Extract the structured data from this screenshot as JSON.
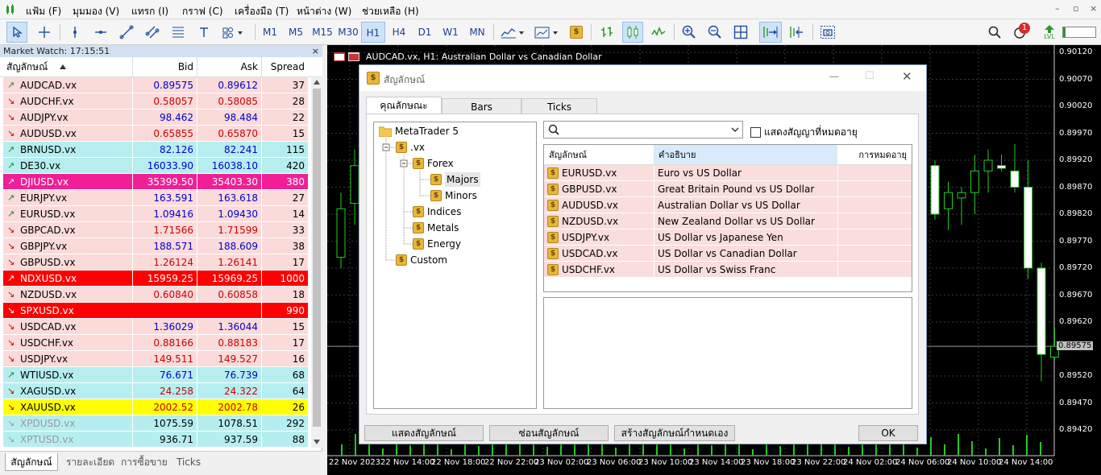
{
  "menu": {
    "items": [
      "แฟ้ม (F)",
      "มุมมอง (V)",
      "แทรก (I)",
      "กราฟ (C)",
      "เครื่องมือ (T)",
      "หน้าต่าง (W)",
      "ช่วยเหลือ (H)"
    ],
    "win_controls": [
      "–",
      "▫",
      "×"
    ]
  },
  "toolbar": {
    "timeframes": [
      "M1",
      "M5",
      "M15",
      "M30",
      "H1",
      "H4",
      "D1",
      "W1",
      "MN"
    ],
    "active_timeframe": "H1",
    "notification_count": "1",
    "lvl_label": "LVL"
  },
  "market_watch": {
    "title": "Market Watch: 17:15:51",
    "close": "×",
    "headers": {
      "symbol": "สัญลักษณ์",
      "bid": "Bid",
      "ask": "Ask",
      "spread": "Spread"
    },
    "rows": [
      {
        "arrow": "↗",
        "symbol": "AUDCAD.vx",
        "bid": "0.89575",
        "ask": "0.89612",
        "spread": "37",
        "bg": "#fbdada",
        "color": "#0000cc",
        "arrowColor": "#1a8a1a"
      },
      {
        "arrow": "↘",
        "symbol": "AUDCHF.vx",
        "bid": "0.58057",
        "ask": "0.58085",
        "spread": "28",
        "bg": "#fbdada",
        "color": "#cc0000",
        "arrowColor": "#cc0000"
      },
      {
        "arrow": "↘",
        "symbol": "AUDJPY.vx",
        "bid": "98.462",
        "ask": "98.484",
        "spread": "22",
        "bg": "#fbdada",
        "color": "#0000cc",
        "arrowColor": "#cc0000"
      },
      {
        "arrow": "↘",
        "symbol": "AUDUSD.vx",
        "bid": "0.65855",
        "ask": "0.65870",
        "spread": "15",
        "bg": "#fbdada",
        "color": "#cc0000",
        "arrowColor": "#cc0000"
      },
      {
        "arrow": "↗",
        "symbol": "BRNUSD.vx",
        "bid": "82.126",
        "ask": "82.241",
        "spread": "115",
        "bg": "#b6eef0",
        "color": "#0000cc",
        "arrowColor": "#1a8a1a"
      },
      {
        "arrow": "↗",
        "symbol": "DE30.vx",
        "bid": "16033.90",
        "ask": "16038.10",
        "spread": "420",
        "bg": "#b6eef0",
        "color": "#0000cc",
        "arrowColor": "#1a8a1a"
      },
      {
        "arrow": "↗",
        "symbol": "DJIUSD.vx",
        "bid": "35399.50",
        "ask": "35403.30",
        "spread": "380",
        "bg": "#f01f96",
        "color": "#0000cc",
        "arrowColor": "#1a8a1a",
        "textColor": "#ffffff"
      },
      {
        "arrow": "↗",
        "symbol": "EURJPY.vx",
        "bid": "163.591",
        "ask": "163.618",
        "spread": "27",
        "bg": "#fbdada",
        "color": "#0000cc",
        "arrowColor": "#1a8a1a"
      },
      {
        "arrow": "↗",
        "symbol": "EURUSD.vx",
        "bid": "1.09416",
        "ask": "1.09430",
        "spread": "14",
        "bg": "#fbdada",
        "color": "#0000cc",
        "arrowColor": "#1a8a1a"
      },
      {
        "arrow": "↘",
        "symbol": "GBPCAD.vx",
        "bid": "1.71566",
        "ask": "1.71599",
        "spread": "33",
        "bg": "#fbdada",
        "color": "#cc0000",
        "arrowColor": "#cc0000"
      },
      {
        "arrow": "↘",
        "symbol": "GBPJPY.vx",
        "bid": "188.571",
        "ask": "188.609",
        "spread": "38",
        "bg": "#fbdada",
        "color": "#0000cc",
        "arrowColor": "#cc0000"
      },
      {
        "arrow": "↘",
        "symbol": "GBPUSD.vx",
        "bid": "1.26124",
        "ask": "1.26141",
        "spread": "17",
        "bg": "#fbdada",
        "color": "#cc0000",
        "arrowColor": "#cc0000"
      },
      {
        "arrow": "↗",
        "symbol": "NDXUSD.vx",
        "bid": "15959.25",
        "ask": "15969.25",
        "spread": "1000",
        "bg": "#ff0000",
        "color": "#0000cc",
        "arrowColor": "#1a8a1a",
        "textColor": "#ffffff"
      },
      {
        "arrow": "↘",
        "symbol": "NZDUSD.vx",
        "bid": "0.60840",
        "ask": "0.60858",
        "spread": "18",
        "bg": "#fbdada",
        "color": "#cc0000",
        "arrowColor": "#cc0000"
      },
      {
        "arrow": "↘",
        "symbol": "SPXUSD.vx",
        "bid": "",
        "ask": "",
        "spread": "990",
        "bg": "#ff0000",
        "color": "#ffffff",
        "arrowColor": "#cc0000",
        "textColor": "#ffffff"
      },
      {
        "arrow": "↘",
        "symbol": "USDCAD.vx",
        "bid": "1.36029",
        "ask": "1.36044",
        "spread": "15",
        "bg": "#fbdada",
        "color": "#0000cc",
        "arrowColor": "#cc0000"
      },
      {
        "arrow": "↘",
        "symbol": "USDCHF.vx",
        "bid": "0.88166",
        "ask": "0.88183",
        "spread": "17",
        "bg": "#fbdada",
        "color": "#cc0000",
        "arrowColor": "#cc0000"
      },
      {
        "arrow": "↘",
        "symbol": "USDJPY.vx",
        "bid": "149.511",
        "ask": "149.527",
        "spread": "16",
        "bg": "#fbdada",
        "color": "#cc0000",
        "arrowColor": "#cc0000"
      },
      {
        "arrow": "↗",
        "symbol": "WTIUSD.vx",
        "bid": "76.671",
        "ask": "76.739",
        "spread": "68",
        "bg": "#b6eef0",
        "color": "#0000cc",
        "arrowColor": "#1a8a1a"
      },
      {
        "arrow": "↘",
        "symbol": "XAGUSD.vx",
        "bid": "24.258",
        "ask": "24.322",
        "spread": "64",
        "bg": "#b6eef0",
        "color": "#cc0000",
        "arrowColor": "#cc0000"
      },
      {
        "arrow": "↘",
        "symbol": "XAUUSD.vx",
        "bid": "2002.52",
        "ask": "2002.78",
        "spread": "26",
        "bg": "#ffff00",
        "color": "#cc0000",
        "arrowColor": "#cc0000"
      },
      {
        "arrow": "↘",
        "symbol": "XPDUSD.vx",
        "bid": "1075.59",
        "ask": "1078.51",
        "spread": "292",
        "bg": "#b6eef0",
        "color": "#000000",
        "arrowColor": "#999999",
        "symColor": "#999999"
      },
      {
        "arrow": "↘",
        "symbol": "XPTUSD.vx",
        "bid": "936.71",
        "ask": "937.59",
        "spread": "88",
        "bg": "#b6eef0",
        "color": "#000000",
        "arrowColor": "#999999",
        "symColor": "#999999"
      }
    ],
    "tabs": [
      "สัญลักษณ์",
      "รายละเอียด",
      "การซื้อขาย",
      "Ticks"
    ]
  },
  "chart": {
    "title": "AUDCAD.vx, H1:  Australian Dollar vs Canadian Dollar",
    "prices": [
      "0.90120",
      "0.90070",
      "0.90020",
      "0.89970",
      "0.89920",
      "0.89870",
      "0.89820",
      "0.89770",
      "0.89720",
      "0.89670",
      "0.89620",
      "0.89575",
      "0.89520",
      "0.89470",
      "0.89420"
    ],
    "current_price": "0.89575",
    "times": [
      "22 Nov 2023",
      "22 Nov 14:00",
      "22 Nov 18:00",
      "22 Nov 22:00",
      "23 Nov 02:00",
      "23 Nov 06:00",
      "23 Nov 10:00",
      "23 Nov 14:00",
      "23 Nov 18:00",
      "23 Nov 22:00",
      "24 Nov 02:00",
      "24 Nov 06:00",
      "24 Nov 10:00",
      "24 Nov 14:00"
    ],
    "candles_left": [
      {
        "o": 0.8974,
        "h": 0.8986,
        "l": 0.8972,
        "c": 0.8983
      },
      {
        "o": 0.8984,
        "h": 0.8994,
        "l": 0.898,
        "c": 0.8991
      }
    ],
    "candles_right": [
      {
        "o": 0.8991,
        "h": 0.8992,
        "l": 0.8981,
        "c": 0.8982
      },
      {
        "o": 0.8983,
        "h": 0.8988,
        "l": 0.8979,
        "c": 0.8986
      },
      {
        "o": 0.8985,
        "h": 0.8987,
        "l": 0.898,
        "c": 0.8986
      },
      {
        "o": 0.8986,
        "h": 0.8993,
        "l": 0.8982,
        "c": 0.899
      },
      {
        "o": 0.899,
        "h": 0.8994,
        "l": 0.8986,
        "c": 0.8992
      },
      {
        "o": 0.8991,
        "h": 0.8993,
        "l": 0.899,
        "c": 0.89905
      },
      {
        "o": 0.899,
        "h": 0.8995,
        "l": 0.8986,
        "c": 0.8987
      },
      {
        "o": 0.8987,
        "h": 0.8992,
        "l": 0.897,
        "c": 0.8972
      },
      {
        "o": 0.8972,
        "h": 0.8973,
        "l": 0.8951,
        "c": 0.8956
      },
      {
        "o": 0.89555,
        "h": 0.8961,
        "l": 0.8955,
        "c": 0.89575
      }
    ]
  },
  "dialog": {
    "title": "สัญลักษณ์",
    "win_controls": [
      "—",
      "☐",
      "✕"
    ],
    "tabs": [
      "คุณลักษณะ",
      "Bars",
      "Ticks"
    ],
    "tree": {
      "root": "MetaTrader 5",
      "group": ".vx",
      "forex": "Forex",
      "majors": "Majors",
      "minors": "Minors",
      "indices": "Indices",
      "metals": "Metals",
      "energy": "Energy",
      "custom": "Custom"
    },
    "search_value": "",
    "show_expired": "แสดงสัญญาที่หมดอายุ",
    "table_headers": [
      "สัญลักษณ์",
      "คำอธิบาย",
      "การหมดอายุ"
    ],
    "symbols": [
      {
        "symbol": "EURUSD.vx",
        "desc": "Euro vs US Dollar"
      },
      {
        "symbol": "GBPUSD.vx",
        "desc": "Great Britain Pound vs US Dollar"
      },
      {
        "symbol": "AUDUSD.vx",
        "desc": "Australian Dollar vs US Dollar"
      },
      {
        "symbol": "NZDUSD.vx",
        "desc": "New Zealand Dollar vs US Dollar"
      },
      {
        "symbol": "USDJPY.vx",
        "desc": "US Dollar vs Japanese Yen"
      },
      {
        "symbol": "USDCAD.vx",
        "desc": "US Dollar vs Canadian Dollar"
      },
      {
        "symbol": "USDCHF.vx",
        "desc": "US Dollar vs Swiss Franc"
      }
    ],
    "buttons": {
      "show": "แสดงสัญลักษณ์",
      "hide": "ซ่อนสัญลักษณ์",
      "create": "สร้างสัญลักษณ์กำหนดเอง",
      "ok": "OK"
    }
  }
}
